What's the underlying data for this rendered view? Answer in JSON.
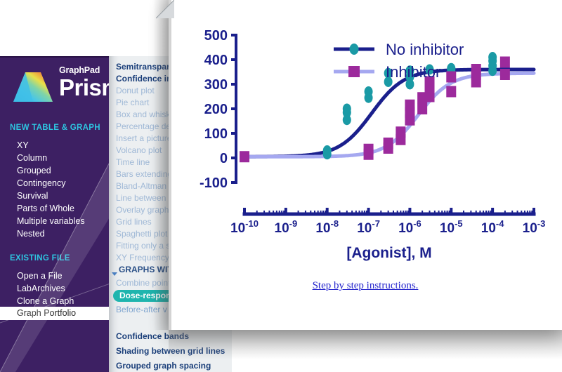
{
  "app": {
    "brand_top": "GraphPad",
    "brand_main": "Prism",
    "logo_icon": "prism-logo-icon"
  },
  "sidebar": {
    "sections": [
      {
        "heading": "NEW TABLE & GRAPH",
        "items": [
          {
            "label": "XY",
            "selected": false
          },
          {
            "label": "Column",
            "selected": false
          },
          {
            "label": "Grouped",
            "selected": false
          },
          {
            "label": "Contingency",
            "selected": false
          },
          {
            "label": "Survival",
            "selected": false
          },
          {
            "label": "Parts of Whole",
            "selected": false
          },
          {
            "label": "Multiple variables",
            "selected": false
          },
          {
            "label": "Nested",
            "selected": false
          }
        ]
      },
      {
        "heading": "EXISTING FILE",
        "items": [
          {
            "label": "Open a File",
            "selected": false
          },
          {
            "label": "LabArchives",
            "selected": false
          },
          {
            "label": "Clone a Graph",
            "selected": false
          },
          {
            "label": "Graph Portfolio",
            "selected": true
          }
        ]
      }
    ]
  },
  "graph_list": {
    "items": [
      {
        "label": "Semitransparent symbols",
        "style": "dark"
      },
      {
        "label": "Confidence intervals",
        "style": "dark"
      },
      {
        "label": "Donut plot",
        "style": "normal"
      },
      {
        "label": "Pie chart",
        "style": "normal"
      },
      {
        "label": "Box and whiskers",
        "style": "normal"
      },
      {
        "label": "Percentage designs",
        "style": "normal"
      },
      {
        "label": "Insert a picture",
        "style": "normal"
      },
      {
        "label": "Volcano plot",
        "style": "normal"
      },
      {
        "label": "Time line",
        "style": "normal"
      },
      {
        "label": "Bars extending",
        "style": "normal"
      },
      {
        "label": "Bland-Altman",
        "style": "normal"
      },
      {
        "label": "Line between",
        "style": "normal"
      },
      {
        "label": "Overlay graph",
        "style": "normal"
      },
      {
        "label": "Grid lines",
        "style": "normal"
      },
      {
        "label": "Spaghetti plot",
        "style": "normal"
      },
      {
        "label": "Fitting only a subset",
        "style": "normal"
      },
      {
        "label": "XY Frequency",
        "style": "normal"
      },
      {
        "label": "GRAPHS WITH FITS",
        "style": "group"
      },
      {
        "label": "Combine points",
        "style": "normal"
      },
      {
        "label": "Dose-response",
        "style": "pill"
      },
      {
        "label": "Before-after v",
        "style": "strike"
      },
      {
        "label": "Confidence bands",
        "style": "dark"
      },
      {
        "label": "Shading between grid lines",
        "style": "dark"
      },
      {
        "label": "Grouped graph spacing",
        "style": "dark"
      }
    ]
  },
  "card": {
    "link_text": "Step by step instructions."
  },
  "colors": {
    "navy": "#1a1f8c",
    "teal": "#1a9aa5",
    "magenta": "#9c2a9c",
    "lavender": "#a5a8f0",
    "axis": "#1a1f8c",
    "sidebar_bg": "#3d2063",
    "accent_cyan": "#2ec4e0",
    "pill_teal": "#1fb5ae",
    "link_blue": "#2222cc"
  },
  "chart_data": {
    "type": "scatter",
    "title": "",
    "xlabel": "[Agonist], M",
    "ylabel": "",
    "xscale": "log",
    "xlim": [
      1e-10,
      0.001
    ],
    "ylim": [
      -100,
      500
    ],
    "yticks": [
      -100,
      0,
      100,
      200,
      300,
      400,
      500
    ],
    "xticks": [
      "10-10",
      "10-9",
      "10-8",
      "10-7",
      "10-6",
      "10-5",
      "10-4",
      "10-3"
    ],
    "xtick_labels": [
      "10⁻¹⁰",
      "10⁻⁹",
      "10⁻⁸",
      "10⁻⁷",
      "10⁻⁶",
      "10⁻⁵",
      "10⁻⁴",
      "10⁻³"
    ],
    "grid": false,
    "legend_position": "top-right",
    "series": [
      {
        "name": "No inhibitor",
        "marker": "circle",
        "marker_color": "#1a9aa5",
        "line_color": "#1a1f8c",
        "ec50": 1.2e-07,
        "top": 360,
        "bottom": 5,
        "points": [
          {
            "x": 1e-10,
            "y": 5
          },
          {
            "x": 1e-08,
            "y": 15
          },
          {
            "x": 1e-08,
            "y": 30
          },
          {
            "x": 3e-08,
            "y": 155
          },
          {
            "x": 3e-08,
            "y": 185
          },
          {
            "x": 3e-08,
            "y": 200
          },
          {
            "x": 1e-07,
            "y": 245
          },
          {
            "x": 1e-07,
            "y": 270
          },
          {
            "x": 3e-07,
            "y": 310
          },
          {
            "x": 3e-07,
            "y": 345
          },
          {
            "x": 1e-06,
            "y": 300
          },
          {
            "x": 1e-06,
            "y": 330
          },
          {
            "x": 1e-06,
            "y": 355
          },
          {
            "x": 3e-06,
            "y": 360
          },
          {
            "x": 1e-05,
            "y": 335
          },
          {
            "x": 1e-05,
            "y": 350
          },
          {
            "x": 1e-05,
            "y": 360
          },
          {
            "x": 1e-05,
            "y": 365
          },
          {
            "x": 0.0001,
            "y": 355
          },
          {
            "x": 0.0001,
            "y": 375
          },
          {
            "x": 0.0001,
            "y": 395
          },
          {
            "x": 0.0001,
            "y": 410
          }
        ]
      },
      {
        "name": "Inhibitor",
        "marker": "square",
        "marker_color": "#9c2a9c",
        "line_color": "#a5a8f0",
        "ec50": 1.6e-06,
        "top": 345,
        "bottom": 5,
        "points": [
          {
            "x": 1e-10,
            "y": 5
          },
          {
            "x": 1e-07,
            "y": 15
          },
          {
            "x": 1e-07,
            "y": 35
          },
          {
            "x": 3e-07,
            "y": 40
          },
          {
            "x": 3e-07,
            "y": 60
          },
          {
            "x": 6e-07,
            "y": 75
          },
          {
            "x": 6e-07,
            "y": 105
          },
          {
            "x": 1e-06,
            "y": 155
          },
          {
            "x": 1e-06,
            "y": 185
          },
          {
            "x": 1e-06,
            "y": 215
          },
          {
            "x": 2e-06,
            "y": 200
          },
          {
            "x": 2e-06,
            "y": 245
          },
          {
            "x": 3e-06,
            "y": 250
          },
          {
            "x": 3e-06,
            "y": 285
          },
          {
            "x": 3e-06,
            "y": 310
          },
          {
            "x": 1e-05,
            "y": 270
          },
          {
            "x": 1e-05,
            "y": 330
          },
          {
            "x": 4e-05,
            "y": 310
          },
          {
            "x": 4e-05,
            "y": 340
          },
          {
            "x": 4e-05,
            "y": 360
          },
          {
            "x": 0.0002,
            "y": 340
          },
          {
            "x": 0.0002,
            "y": 390
          }
        ]
      }
    ]
  }
}
